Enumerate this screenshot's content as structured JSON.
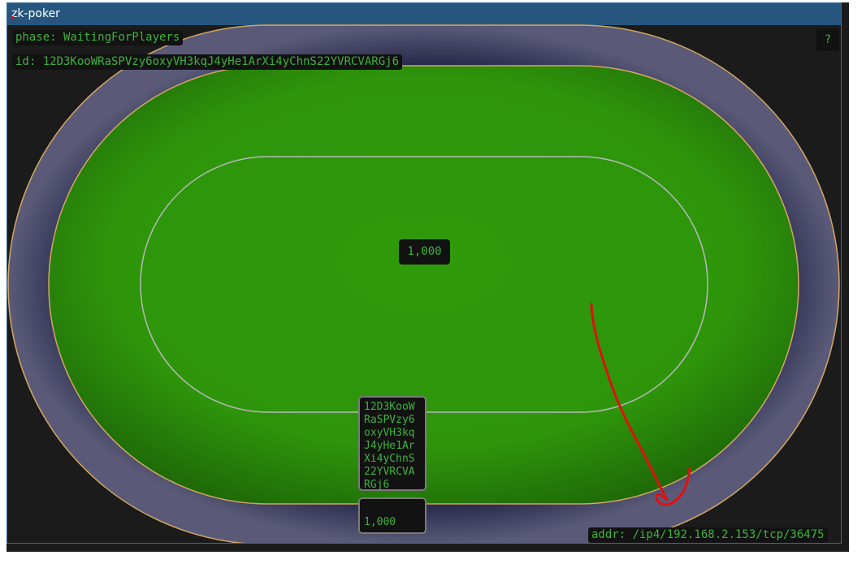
{
  "window": {
    "title": "zk-poker"
  },
  "status": {
    "phase": "phase: WaitingForPlayers",
    "id": "id: 12D3KooWRaSPVzy6oxyVH3kqJ4yHe1ArXi4yChnS22YVRCVARGj6",
    "help": "?",
    "addr": "addr: /ip4/192.168.2.153/tcp/36475"
  },
  "table": {
    "pot": "1,000",
    "felt_color": "#2f9a0a",
    "rail_color": "#252545",
    "trim_color": "#d2a761",
    "accent_text_color": "#3fb13f"
  },
  "seat": {
    "player_id": "12D3KooWRaSPVzy6oxyVH3kqJ4yHe1ArXi4yChnS22YVRCVARGj6",
    "stack": "1,000"
  },
  "annotation": {
    "color": "#e01010",
    "shape": "hand-drawn arrow"
  }
}
